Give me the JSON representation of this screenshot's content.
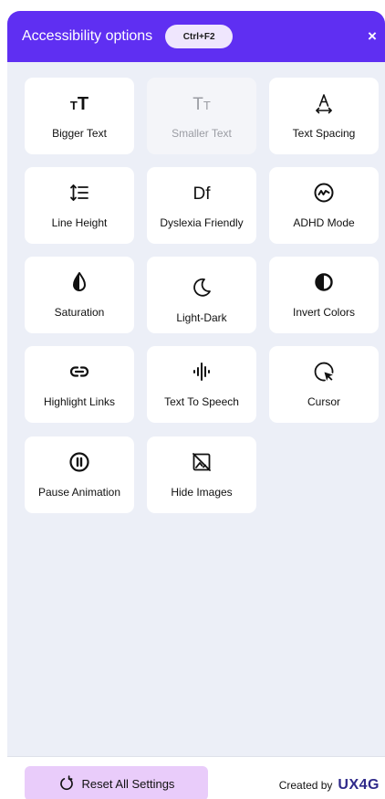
{
  "header": {
    "title": "Accessibility options",
    "shortcut": "Ctrl+F2",
    "close": "×"
  },
  "options": {
    "bigger_text": "Bigger Text",
    "smaller_text": "Smaller Text",
    "text_spacing": "Text Spacing",
    "line_height": "Line Height",
    "dyslexia_friendly": "Dyslexia Friendly",
    "adhd_mode": "ADHD Mode",
    "saturation": "Saturation",
    "light_dark": "Light-Dark",
    "invert_colors": "Invert Colors",
    "highlight_links": "Highlight Links",
    "text_to_speech": "Text To Speech",
    "cursor": "Cursor",
    "pause_animation": "Pause Animation",
    "hide_images": "Hide Images"
  },
  "footer": {
    "reset_label": "Reset All Settings",
    "created_by": "Created by",
    "brand": "UX4G"
  },
  "colors": {
    "header_bg": "#5f2ff2",
    "panel_bg": "#eceff7",
    "reset_bg": "#e9ccfa",
    "brand": "#2f2a8a"
  }
}
